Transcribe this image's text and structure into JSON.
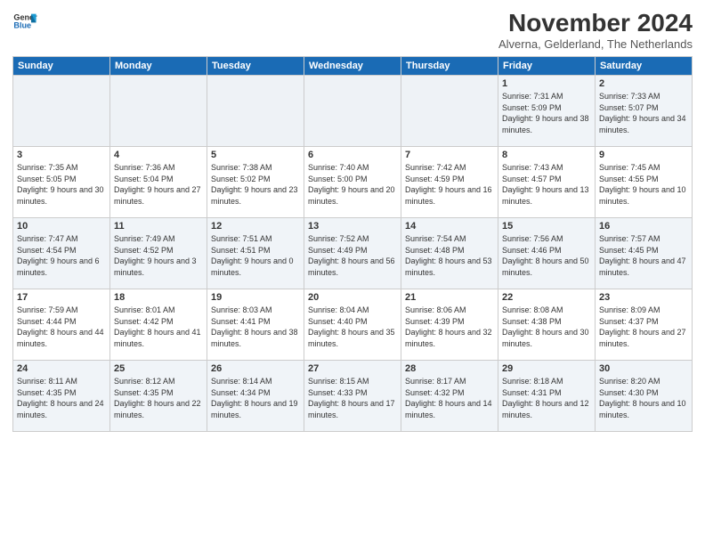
{
  "logo": {
    "line1": "General",
    "line2": "Blue"
  },
  "title": "November 2024",
  "subtitle": "Alverna, Gelderland, The Netherlands",
  "weekdays": [
    "Sunday",
    "Monday",
    "Tuesday",
    "Wednesday",
    "Thursday",
    "Friday",
    "Saturday"
  ],
  "weeks": [
    [
      {
        "day": "",
        "info": ""
      },
      {
        "day": "",
        "info": ""
      },
      {
        "day": "",
        "info": ""
      },
      {
        "day": "",
        "info": ""
      },
      {
        "day": "",
        "info": ""
      },
      {
        "day": "1",
        "info": "Sunrise: 7:31 AM\nSunset: 5:09 PM\nDaylight: 9 hours and 38 minutes."
      },
      {
        "day": "2",
        "info": "Sunrise: 7:33 AM\nSunset: 5:07 PM\nDaylight: 9 hours and 34 minutes."
      }
    ],
    [
      {
        "day": "3",
        "info": "Sunrise: 7:35 AM\nSunset: 5:05 PM\nDaylight: 9 hours and 30 minutes."
      },
      {
        "day": "4",
        "info": "Sunrise: 7:36 AM\nSunset: 5:04 PM\nDaylight: 9 hours and 27 minutes."
      },
      {
        "day": "5",
        "info": "Sunrise: 7:38 AM\nSunset: 5:02 PM\nDaylight: 9 hours and 23 minutes."
      },
      {
        "day": "6",
        "info": "Sunrise: 7:40 AM\nSunset: 5:00 PM\nDaylight: 9 hours and 20 minutes."
      },
      {
        "day": "7",
        "info": "Sunrise: 7:42 AM\nSunset: 4:59 PM\nDaylight: 9 hours and 16 minutes."
      },
      {
        "day": "8",
        "info": "Sunrise: 7:43 AM\nSunset: 4:57 PM\nDaylight: 9 hours and 13 minutes."
      },
      {
        "day": "9",
        "info": "Sunrise: 7:45 AM\nSunset: 4:55 PM\nDaylight: 9 hours and 10 minutes."
      }
    ],
    [
      {
        "day": "10",
        "info": "Sunrise: 7:47 AM\nSunset: 4:54 PM\nDaylight: 9 hours and 6 minutes."
      },
      {
        "day": "11",
        "info": "Sunrise: 7:49 AM\nSunset: 4:52 PM\nDaylight: 9 hours and 3 minutes."
      },
      {
        "day": "12",
        "info": "Sunrise: 7:51 AM\nSunset: 4:51 PM\nDaylight: 9 hours and 0 minutes."
      },
      {
        "day": "13",
        "info": "Sunrise: 7:52 AM\nSunset: 4:49 PM\nDaylight: 8 hours and 56 minutes."
      },
      {
        "day": "14",
        "info": "Sunrise: 7:54 AM\nSunset: 4:48 PM\nDaylight: 8 hours and 53 minutes."
      },
      {
        "day": "15",
        "info": "Sunrise: 7:56 AM\nSunset: 4:46 PM\nDaylight: 8 hours and 50 minutes."
      },
      {
        "day": "16",
        "info": "Sunrise: 7:57 AM\nSunset: 4:45 PM\nDaylight: 8 hours and 47 minutes."
      }
    ],
    [
      {
        "day": "17",
        "info": "Sunrise: 7:59 AM\nSunset: 4:44 PM\nDaylight: 8 hours and 44 minutes."
      },
      {
        "day": "18",
        "info": "Sunrise: 8:01 AM\nSunset: 4:42 PM\nDaylight: 8 hours and 41 minutes."
      },
      {
        "day": "19",
        "info": "Sunrise: 8:03 AM\nSunset: 4:41 PM\nDaylight: 8 hours and 38 minutes."
      },
      {
        "day": "20",
        "info": "Sunrise: 8:04 AM\nSunset: 4:40 PM\nDaylight: 8 hours and 35 minutes."
      },
      {
        "day": "21",
        "info": "Sunrise: 8:06 AM\nSunset: 4:39 PM\nDaylight: 8 hours and 32 minutes."
      },
      {
        "day": "22",
        "info": "Sunrise: 8:08 AM\nSunset: 4:38 PM\nDaylight: 8 hours and 30 minutes."
      },
      {
        "day": "23",
        "info": "Sunrise: 8:09 AM\nSunset: 4:37 PM\nDaylight: 8 hours and 27 minutes."
      }
    ],
    [
      {
        "day": "24",
        "info": "Sunrise: 8:11 AM\nSunset: 4:35 PM\nDaylight: 8 hours and 24 minutes."
      },
      {
        "day": "25",
        "info": "Sunrise: 8:12 AM\nSunset: 4:35 PM\nDaylight: 8 hours and 22 minutes."
      },
      {
        "day": "26",
        "info": "Sunrise: 8:14 AM\nSunset: 4:34 PM\nDaylight: 8 hours and 19 minutes."
      },
      {
        "day": "27",
        "info": "Sunrise: 8:15 AM\nSunset: 4:33 PM\nDaylight: 8 hours and 17 minutes."
      },
      {
        "day": "28",
        "info": "Sunrise: 8:17 AM\nSunset: 4:32 PM\nDaylight: 8 hours and 14 minutes."
      },
      {
        "day": "29",
        "info": "Sunrise: 8:18 AM\nSunset: 4:31 PM\nDaylight: 8 hours and 12 minutes."
      },
      {
        "day": "30",
        "info": "Sunrise: 8:20 AM\nSunset: 4:30 PM\nDaylight: 8 hours and 10 minutes."
      }
    ]
  ]
}
